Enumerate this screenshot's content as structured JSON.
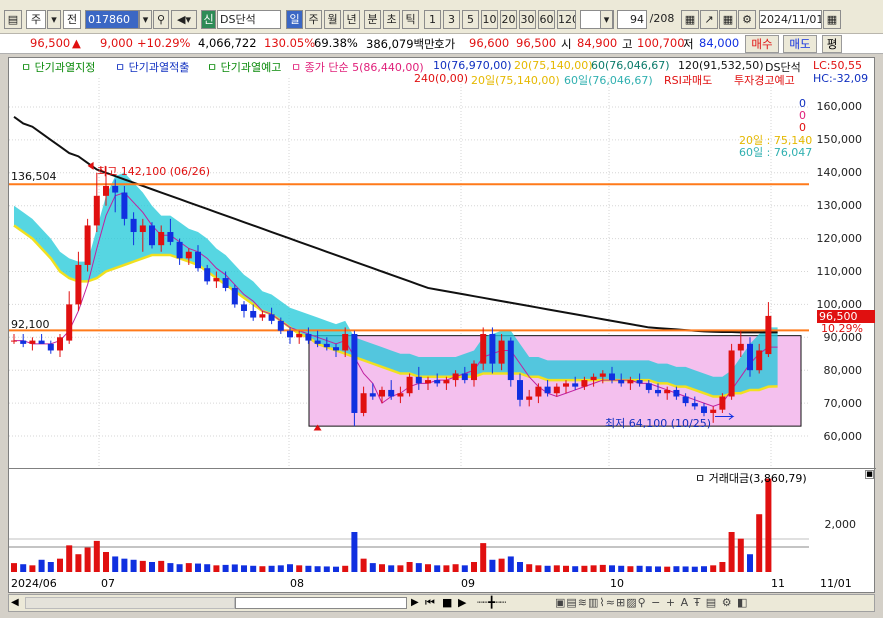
{
  "toolbar": {
    "stock_kind": "주",
    "search_mode": "전",
    "code": "017860",
    "sig": "신",
    "chart_name": "DS단석",
    "periods": [
      "일",
      "주",
      "월",
      "년",
      "분",
      "초",
      "틱"
    ],
    "active_period": "일",
    "intervals": [
      "1",
      "3",
      "5",
      "10",
      "20",
      "30",
      "60",
      "120"
    ],
    "count": "94",
    "count_total": "/208",
    "date": "2024/11/01"
  },
  "quote": {
    "price": "96,500",
    "change_arrow": "▲",
    "change": "9,000",
    "change_pct": "+10.29%",
    "volume": "4,066,722",
    "ratio1": "130.05%",
    "ratio2": "69.38%",
    "amount": "386,079백만",
    "hoga_label": "호가",
    "hoga_ask": "96,600",
    "hoga_bid": "96,500",
    "open_label": "시",
    "open": "84,900",
    "high_label": "고",
    "high": "100,700",
    "low_label": "저",
    "low": "84,000",
    "buy": "매수",
    "sell": "매도",
    "eval": "평"
  },
  "legend": {
    "l1": "ㅁ 단기과열지정",
    "l2": "ㅁ 단기과열적출",
    "l3": "ㅁ 단기과열예고",
    "l4": "ㅁ 종가 단순 5(86,440,00)",
    "l5": "10(76,970,00)",
    "l6": "20(75,140,00)",
    "l7": "60(76,046,67)",
    "l8": "120(91,532,50)",
    "l9": "DS단석",
    "l10": "240(0,00)",
    "l11": "20일(75,140,00)",
    "l12": "60일(76,046,67)",
    "l13": "RSI과매도",
    "l14": "투자경고예고",
    "lc": "LC:50,55",
    "hc": "HC:-32,09",
    "zero1": "0",
    "zero2": "0",
    "zero3": "0",
    "ma20_label": "20일 : 75,140",
    "ma60_label": "60일 : 76,047"
  },
  "annotations": {
    "high_text": "최고 142,100 (06/26)",
    "low_text": "최저 64,100 (10/25)",
    "level_high": "136,504",
    "level_low": "92,100",
    "price_tag": "96,500",
    "pct_tag": "10.29%"
  },
  "volume_panel": {
    "title": "ㅁ 거래대금(3,860,79)",
    "tick": "2,000"
  },
  "xaxis": {
    "labels": [
      "2024/06",
      "07",
      "08",
      "09",
      "10",
      "11",
      "11/01"
    ]
  },
  "chart_data": {
    "type": "candlestick",
    "title": "DS단석",
    "y_axis": [
      "160,000",
      "150,000",
      "140,000",
      "130,000",
      "120,000",
      "110,000",
      "100,000",
      "90,000",
      "80,000",
      "70,000",
      "60,000"
    ],
    "ylim": [
      60000,
      165000
    ],
    "candles": [
      [
        89,
        91,
        88,
        89
      ],
      [
        89,
        91,
        87,
        88
      ],
      [
        88,
        90,
        86,
        89
      ],
      [
        89,
        91,
        88,
        88
      ],
      [
        88,
        89,
        85,
        86
      ],
      [
        86,
        91,
        84,
        90
      ],
      [
        89,
        104,
        88,
        100
      ],
      [
        100,
        116,
        98,
        112
      ],
      [
        112,
        126,
        110,
        124
      ],
      [
        124,
        140,
        122,
        133
      ],
      [
        133,
        142,
        130,
        136
      ],
      [
        136,
        138,
        128,
        134
      ],
      [
        134,
        136,
        124,
        126
      ],
      [
        126,
        128,
        118,
        122
      ],
      [
        122,
        126,
        116,
        124
      ],
      [
        124,
        125,
        117,
        118
      ],
      [
        118,
        124,
        116,
        122
      ],
      [
        122,
        126,
        118,
        119
      ],
      [
        119,
        120,
        112,
        114
      ],
      [
        114,
        117,
        112,
        116
      ],
      [
        116,
        118,
        110,
        111
      ],
      [
        111,
        112,
        106,
        107
      ],
      [
        107,
        110,
        105,
        108
      ],
      [
        108,
        110,
        104,
        105
      ],
      [
        105,
        106,
        99,
        100
      ],
      [
        100,
        101,
        96,
        98
      ],
      [
        98,
        100,
        95,
        96
      ],
      [
        96,
        98,
        95,
        97
      ],
      [
        97,
        99,
        94,
        95
      ],
      [
        95,
        96,
        91,
        92
      ],
      [
        92,
        93,
        88,
        90
      ],
      [
        90,
        92,
        88,
        91
      ],
      [
        91,
        93,
        88,
        89
      ],
      [
        89,
        92,
        87,
        88
      ],
      [
        88,
        90,
        86,
        87
      ],
      [
        87,
        88,
        84,
        86
      ],
      [
        86,
        93,
        84,
        91
      ],
      [
        91,
        92,
        63,
        67
      ],
      [
        67,
        75,
        66,
        73
      ],
      [
        73,
        76,
        71,
        72
      ],
      [
        72,
        75,
        70,
        74
      ],
      [
        74,
        77,
        71,
        72
      ],
      [
        72,
        75,
        70,
        73
      ],
      [
        73,
        79,
        72,
        78
      ],
      [
        78,
        81,
        74,
        76
      ],
      [
        76,
        78,
        74,
        77
      ],
      [
        77,
        79,
        75,
        76
      ],
      [
        76,
        78,
        74,
        77
      ],
      [
        77,
        80,
        75,
        79
      ],
      [
        79,
        81,
        76,
        77
      ],
      [
        77,
        83,
        75,
        82
      ],
      [
        82,
        93,
        80,
        91
      ],
      [
        91,
        93,
        79,
        82
      ],
      [
        82,
        91,
        80,
        89
      ],
      [
        89,
        90,
        75,
        77
      ],
      [
        77,
        79,
        69,
        71
      ],
      [
        71,
        74,
        69,
        72
      ],
      [
        72,
        76,
        70,
        75
      ],
      [
        75,
        77,
        72,
        73
      ],
      [
        73,
        76,
        72,
        75
      ],
      [
        75,
        77,
        73,
        76
      ],
      [
        76,
        78,
        74,
        75
      ],
      [
        75,
        78,
        74,
        77
      ],
      [
        77,
        79,
        75,
        78
      ],
      [
        78,
        80,
        76,
        79
      ],
      [
        79,
        81,
        76,
        77
      ],
      [
        77,
        79,
        75,
        76
      ],
      [
        76,
        78,
        74,
        77
      ],
      [
        77,
        79,
        75,
        76
      ],
      [
        76,
        77,
        73,
        74
      ],
      [
        74,
        76,
        72,
        73
      ],
      [
        73,
        75,
        71,
        74
      ],
      [
        74,
        75,
        71,
        72
      ],
      [
        72,
        73,
        69,
        70
      ],
      [
        70,
        72,
        68,
        69
      ],
      [
        69,
        70,
        66,
        67
      ],
      [
        67,
        69,
        64,
        68
      ],
      [
        68,
        73,
        67,
        72
      ],
      [
        72,
        88,
        71,
        86
      ],
      [
        86,
        92,
        84,
        88
      ],
      [
        88,
        90,
        78,
        80
      ],
      [
        80,
        88,
        79,
        86
      ],
      [
        84.9,
        100.7,
        84,
        96.5
      ]
    ],
    "ma5": [
      89,
      89,
      88,
      88,
      88,
      89,
      92,
      98,
      106,
      117,
      127,
      133,
      134,
      131,
      128,
      124,
      121,
      121,
      119,
      117,
      116,
      114,
      111,
      109,
      106,
      103,
      101,
      98,
      97,
      95,
      93,
      92,
      91,
      90,
      89,
      88,
      89,
      84,
      79,
      76,
      70,
      72,
      73,
      75,
      76,
      76,
      77,
      77,
      78,
      79,
      80,
      84,
      85,
      86,
      86,
      82,
      78,
      75,
      73,
      72,
      73,
      74,
      75,
      76,
      77,
      77,
      77,
      77,
      76,
      76,
      75,
      74,
      73,
      72,
      71,
      70,
      69,
      70,
      74,
      78,
      82,
      85,
      87,
      87
    ],
    "ma20": [
      124,
      122,
      120,
      117,
      114,
      110,
      108,
      107,
      107,
      108,
      110,
      111,
      112,
      113,
      114,
      115,
      115,
      115,
      114,
      113,
      112,
      110,
      108,
      106,
      104,
      102,
      100,
      98,
      97,
      95,
      93,
      91,
      90,
      88,
      87,
      86,
      85,
      84,
      83,
      82,
      81,
      80,
      79,
      79,
      78,
      78,
      78,
      78,
      78,
      78,
      78,
      79,
      79,
      79,
      79,
      79,
      78,
      78,
      77,
      77,
      77,
      77,
      77,
      77,
      77,
      77,
      77,
      77,
      77,
      77,
      76,
      76,
      75,
      75,
      74,
      73,
      72,
      72,
      73,
      73,
      74,
      74,
      75,
      75.1
    ],
    "ma120": [
      157,
      155,
      154,
      152,
      150,
      148,
      146,
      145,
      143,
      141,
      140,
      139,
      138,
      137,
      136,
      135,
      134,
      133,
      132,
      131,
      130,
      129,
      128,
      127,
      126,
      125,
      124,
      123,
      122,
      121,
      120,
      119,
      118,
      117,
      116,
      115,
      114,
      113,
      112,
      111,
      110,
      109,
      108,
      107,
      106,
      105,
      104.5,
      104,
      103.5,
      103,
      102.5,
      102,
      101.5,
      101,
      100.5,
      100,
      99.5,
      99,
      98.5,
      98,
      97.5,
      97,
      96.5,
      96,
      95.5,
      95,
      94.5,
      94,
      93.5,
      93,
      92.8,
      92.6,
      92.4,
      92.2,
      92,
      91.8,
      91.7,
      91.6,
      91.6,
      91.5,
      91.5,
      91.5,
      91.5,
      91.5
    ],
    "volume": [
      40,
      35,
      30,
      55,
      45,
      60,
      120,
      80,
      110,
      140,
      90,
      70,
      60,
      55,
      50,
      45,
      50,
      40,
      35,
      40,
      38,
      35,
      30,
      32,
      34,
      30,
      28,
      26,
      28,
      30,
      35,
      30,
      28,
      26,
      25,
      24,
      28,
      180,
      60,
      40,
      35,
      30,
      30,
      45,
      40,
      35,
      30,
      30,
      35,
      30,
      45,
      130,
      55,
      60,
      70,
      45,
      35,
      30,
      28,
      30,
      28,
      26,
      28,
      30,
      32,
      30,
      28,
      26,
      28,
      26,
      25,
      24,
      26,
      25,
      24,
      26,
      30,
      45,
      180,
      150,
      80,
      260,
      420
    ],
    "vmax": 450
  }
}
